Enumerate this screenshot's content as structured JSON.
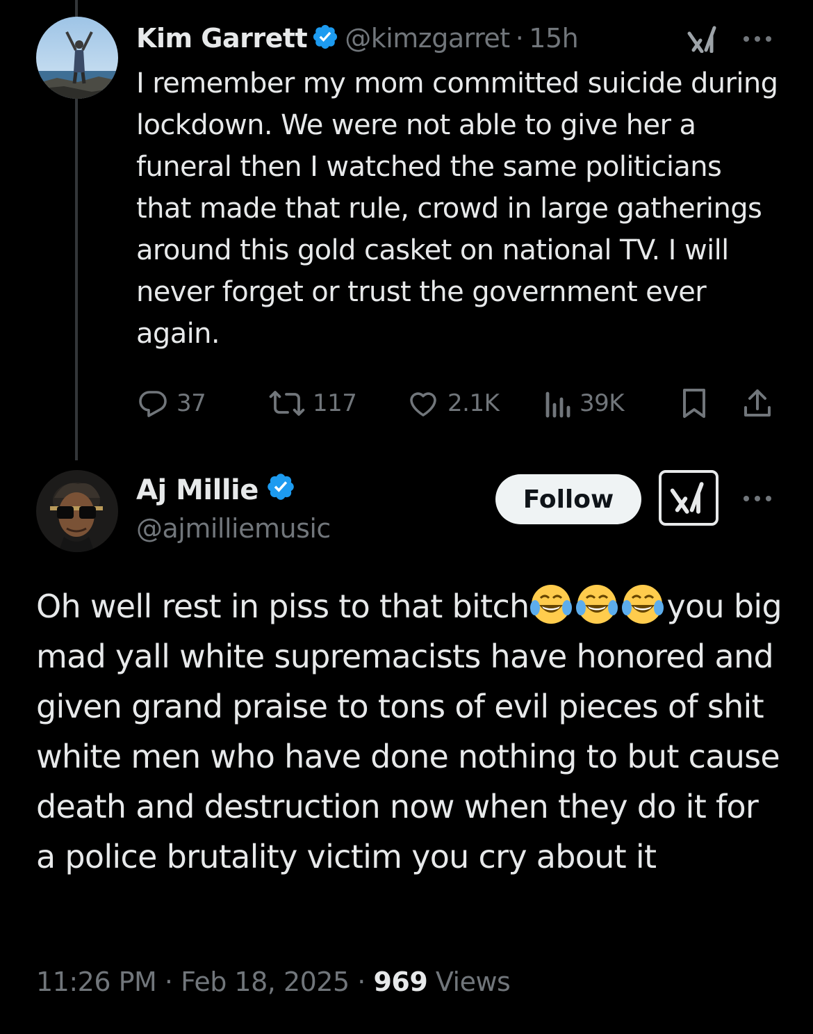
{
  "parent_tweet": {
    "author_name": "Kim Garrett",
    "handle": "@kimzgarret",
    "separator": "·",
    "time_ago": "15h",
    "text": "I remember my mom committed suicide during lockdown. We were not able to give her a funeral then I watched the same politicians that made that rule, crowd in large gatherings around this gold casket on national TV. I will never forget or trust the government ever again.",
    "stats": {
      "replies": "37",
      "reposts": "117",
      "likes": "2.1K",
      "views": "39K"
    }
  },
  "reply_tweet": {
    "author_name": "Aj Millie",
    "handle": "@ajmilliemusic",
    "follow_label": "Follow",
    "text_before_emoji": "Oh well rest in piss to that bitch",
    "emojis": [
      "face-with-tears-of-joy",
      "face-with-tears-of-joy",
      "face-with-tears-of-joy"
    ],
    "text_after_emoji": "you big mad yall white supremacists have honored and given grand praise to tons of evil pieces of shit white men who have done nothing to but cause death and destruction now when they do it for a police brutality victim you cry about it",
    "time": "11:26 PM",
    "separator": "·",
    "date": "Feb 18, 2025",
    "views_count": "969",
    "views_label": "Views"
  },
  "colors": {
    "background": "#000000",
    "text_primary": "#e7e9ea",
    "text_secondary": "#71767b",
    "verified_blue": "#1d9bf0",
    "thread_line": "#333639",
    "follow_bg": "#eff3f4"
  },
  "icons": {
    "verified": "verified-badge-icon",
    "grok": "grok-icon",
    "more": "more-dots-icon",
    "reply": "reply-icon",
    "repost": "repost-icon",
    "like": "heart-icon",
    "views": "views-bar-chart-icon",
    "bookmark": "bookmark-icon",
    "share": "share-icon"
  }
}
